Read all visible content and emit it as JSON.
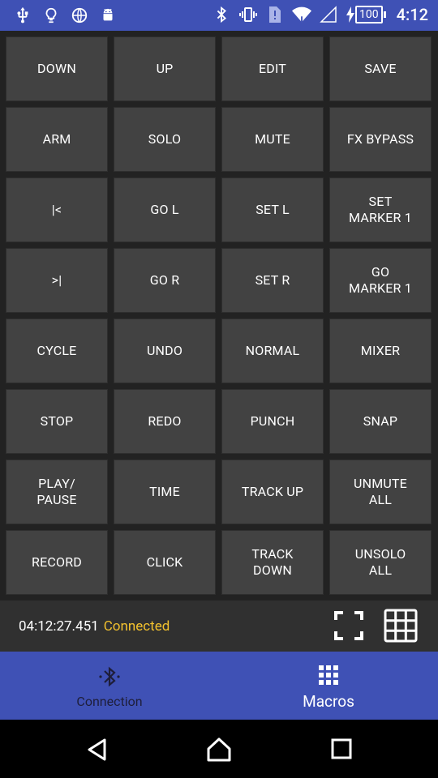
{
  "status_bar": {
    "clock": "4:12",
    "battery_level": "100",
    "icons_left": [
      "usb-icon",
      "lightbulb-icon",
      "globe-icon",
      "android-icon"
    ],
    "icons_right": [
      "bluetooth-icon",
      "vibrate-icon",
      "sim-alert-icon",
      "wifi-icon",
      "signal-icon",
      "charging-icon"
    ]
  },
  "macros": [
    "DOWN",
    "UP",
    "EDIT",
    "SAVE",
    "ARM",
    "SOLO",
    "MUTE",
    "FX BYPASS",
    "|<",
    "GO L",
    "SET L",
    "SET\nMARKER 1",
    ">|",
    "GO R",
    "SET R",
    "GO\nMARKER 1",
    "CYCLE",
    "UNDO",
    "NORMAL",
    "MIXER",
    "STOP",
    "REDO",
    "PUNCH",
    "SNAP",
    "PLAY/\nPAUSE",
    "TIME",
    "TRACK UP",
    "UNMUTE\nALL",
    "RECORD",
    "CLICK",
    "TRACK\nDOWN",
    "UNSOLO\nALL"
  ],
  "info": {
    "timecode": "04:12:27.451",
    "status": "Connected"
  },
  "bottom_nav": {
    "connection_label": "Connection",
    "macros_label": "Macros",
    "active_tab": "Macros"
  },
  "colors": {
    "primary": "#3f51b5",
    "button_bg": "#424242",
    "connected": "#f2c12e"
  }
}
